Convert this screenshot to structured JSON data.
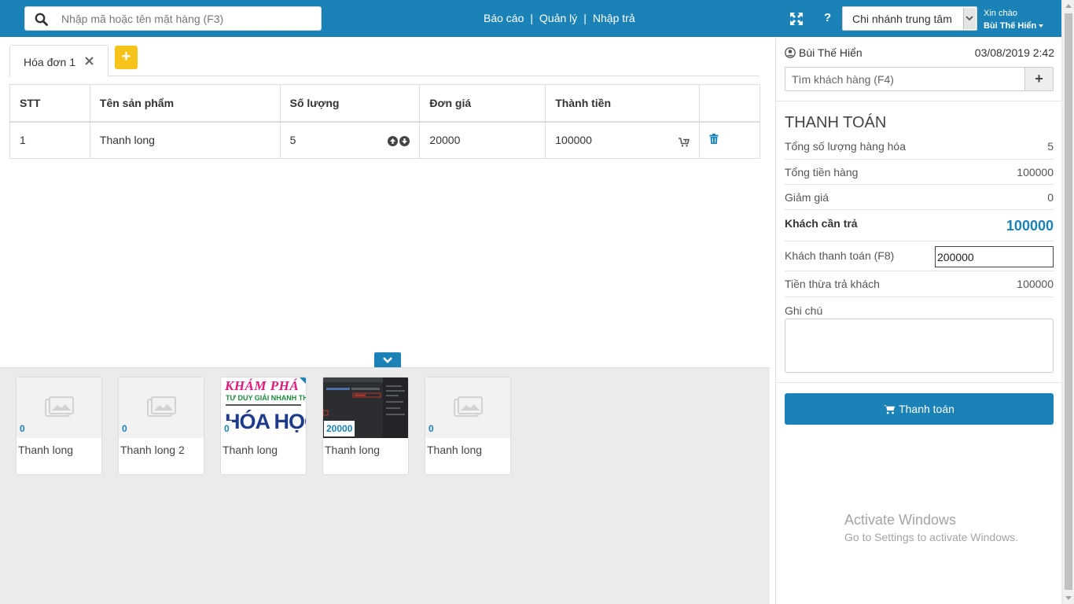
{
  "colors": {
    "accent": "#1b82b8",
    "add_tab": "#f5c319",
    "book_pink": "#e4177b",
    "book_green": "#1a8b3b",
    "book_navy": "#1e3a8a"
  },
  "header": {
    "search_placeholder": "Nhập mã hoặc tên mặt hàng (F3)",
    "nav": [
      {
        "label": "Báo cáo"
      },
      {
        "label": "Quản lý"
      },
      {
        "label": "Nhập trả"
      }
    ],
    "nav_separator": "|",
    "help_label": "?",
    "branch": "Chi nhánh trung tâm",
    "greeting": "Xin chào",
    "user_name": "Bùi Thế Hiển",
    "icons": {
      "search": "search-icon",
      "fullscreen": "expand-icon",
      "dropdown": "chevron-down-icon"
    }
  },
  "tabs": {
    "items": [
      {
        "label": "Hóa đơn 1"
      }
    ],
    "add_label": "+"
  },
  "cart": {
    "headers": [
      "STT",
      "Tên sản phẩm",
      "Số lượng",
      "Đơn giá",
      "Thành tiền",
      ""
    ],
    "rows": [
      {
        "stt": "1",
        "name": "Thanh long",
        "qty": "5",
        "price": "20000",
        "total": "100000"
      }
    ]
  },
  "products": [
    {
      "price": "0",
      "name": "Thanh long",
      "image": "placeholder"
    },
    {
      "price": "0",
      "name": "Thanh long 2",
      "image": "placeholder"
    },
    {
      "price": "0",
      "name": "Thanh long",
      "image": "book-cover",
      "cover_text": {
        "title": "KHÁM PHÁ",
        "subtitle": "TƯ DUY GIẢI NHANH THẦN TỐC",
        "big": "HÓA HỌC"
      }
    },
    {
      "price": "20000",
      "name": "Thanh long",
      "image": "screenshot"
    },
    {
      "price": "0",
      "name": "Thanh long",
      "image": "placeholder"
    }
  ],
  "panel": {
    "cashier": "Bùi Thế Hiển",
    "datetime": "03/08/2019 2:42",
    "customer_placeholder": "Tìm khách hàng (F4)",
    "add_customer_label": "+",
    "heading": "THANH TOÁN",
    "summary": {
      "total_qty_label": "Tổng số lượng hàng hóa",
      "total_qty": "5",
      "total_amount_label": "Tổng tiền hàng",
      "total_amount": "100000",
      "discount_label": "Giảm giá",
      "discount": "0",
      "to_pay_label": "Khách cần trả",
      "to_pay": "100000",
      "paid_label": "Khách thanh toán (F8)",
      "paid": "200000",
      "change_label": "Tiền thừa trả khách",
      "change": "100000"
    },
    "note_label": "Ghi chú",
    "pay_button": "Thanh toán"
  },
  "watermark": {
    "line1": "Activate Windows",
    "line2": "Go to Settings to activate Windows."
  }
}
